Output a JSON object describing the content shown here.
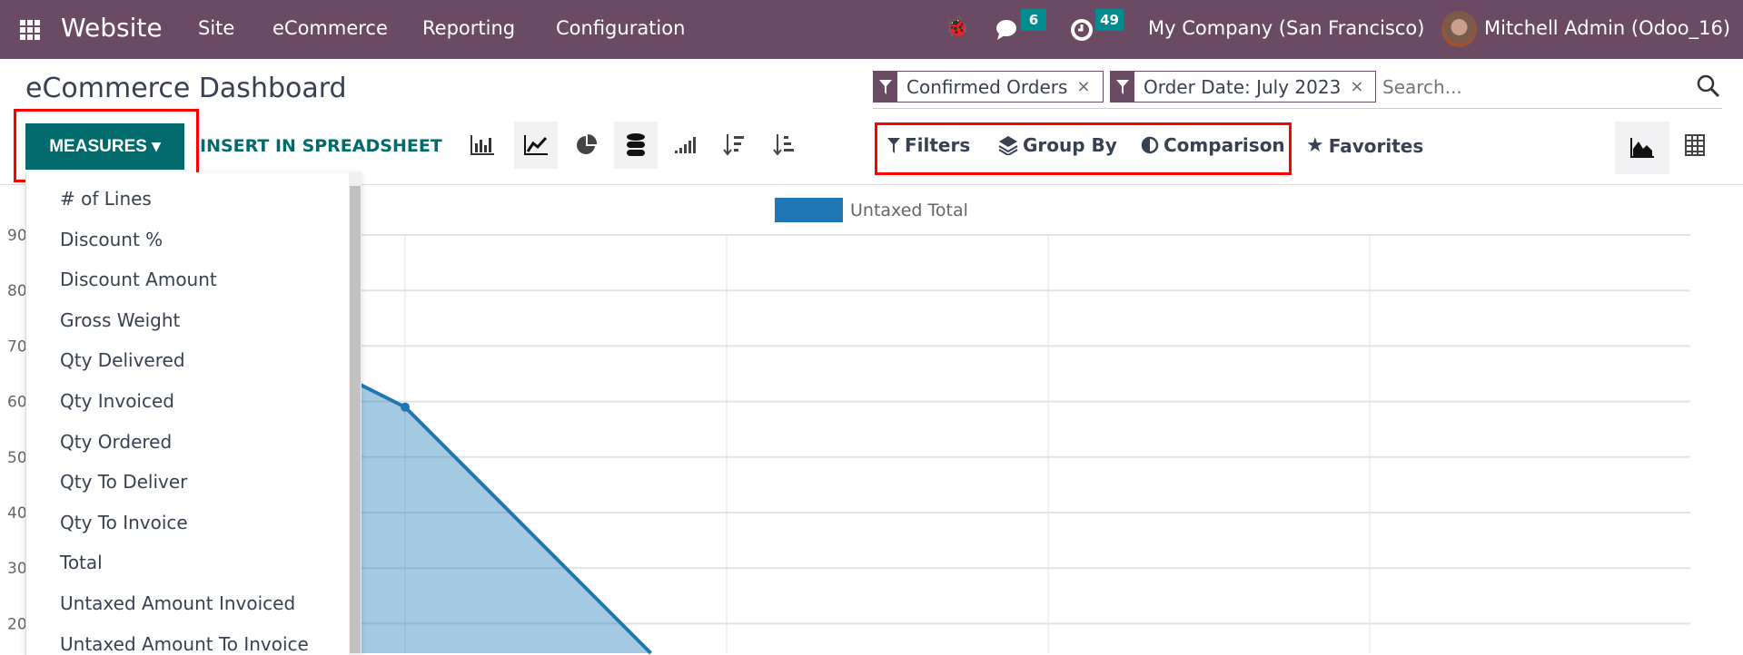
{
  "navbar": {
    "app": "Website",
    "menu": [
      "Site",
      "eCommerce",
      "Reporting",
      "Configuration"
    ],
    "messages_badge": "6",
    "activities_badge": "49",
    "company": "My Company (San Francisco)",
    "user": "Mitchell Admin (Odoo_16)",
    "color": "#6b4b64"
  },
  "page": {
    "title": "eCommerce Dashboard"
  },
  "toolbar": {
    "measures": "MEASURES",
    "insert": "INSERT IN SPREADSHEET",
    "accent": "#016a6c"
  },
  "search": {
    "facets": [
      "Confirmed Orders",
      "Order Date: July 2023"
    ],
    "placeholder": "Search..."
  },
  "filters": {
    "filters": "Filters",
    "group_by": "Group By",
    "comparison": "Comparison",
    "favorites": "Favorites"
  },
  "measures_menu": [
    "# of Lines",
    "Discount %",
    "Discount Amount",
    "Gross Weight",
    "Qty Delivered",
    "Qty Invoiced",
    "Qty Ordered",
    "Qty To Deliver",
    "Qty To Invoice",
    "Total",
    "Untaxed Amount Invoiced",
    "Untaxed Amount To Invoice"
  ],
  "chart_data": {
    "type": "area",
    "series": [
      {
        "name": "Untaxed Total",
        "values": [
          88,
          59,
          1,
          0,
          0
        ],
        "color": "#1f77b4"
      }
    ],
    "y_ticks": [
      "90",
      "80",
      "70",
      "60",
      "50",
      "40",
      "30",
      "20"
    ],
    "ylim_visible": [
      15,
      90
    ],
    "grid": true,
    "legend": "top"
  }
}
